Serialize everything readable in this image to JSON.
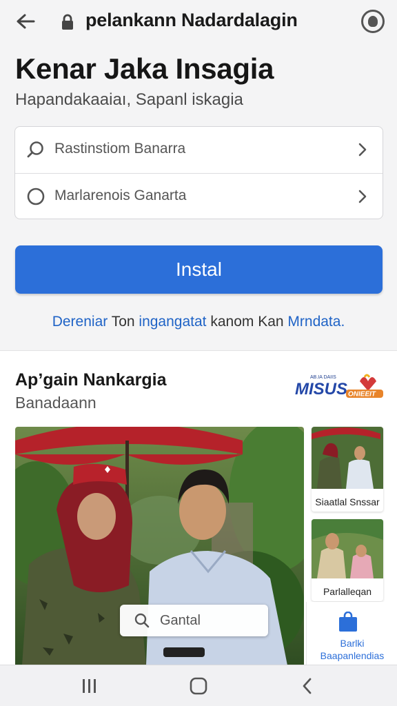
{
  "browser": {
    "url": "pelankann Nadardalagin",
    "icons": {
      "back": "back-arrow-icon",
      "lock": "lock-icon",
      "site": "site-info-icon"
    }
  },
  "header": {
    "title": "Kenar Jaka Insagia",
    "subtitle": "Hapandakaaiaı, Sapanl iskagia"
  },
  "options": [
    {
      "label": "Rastinstiom Banarra",
      "icon": "search-icon"
    },
    {
      "label": "Marlarenois Ganarta",
      "icon": "radio-circle-icon"
    }
  ],
  "install_label": "Instal",
  "note": {
    "part1": "Dereniar",
    "part2": " Ton ",
    "part3": "ingangatat",
    "part4": " kanom Kan ",
    "part5": "Mrndata."
  },
  "section": {
    "title": "Apʼgain Nankargia",
    "subtitle": "Banadaann",
    "logo": {
      "main": "MISUS",
      "small_top": "AB.IA DAIIS",
      "accent": "ONIEEIT"
    },
    "search_value": "Gantal",
    "thumbs": [
      {
        "caption": "Siaatlal Snssar"
      },
      {
        "caption": "Parlalleqan"
      }
    ],
    "blue_card": {
      "line1": "Barlki",
      "line2": "Baapanlendias"
    }
  },
  "colors": {
    "accent": "#2c6fd9",
    "link": "#1f63c6",
    "brand_red": "#d33a3a"
  }
}
